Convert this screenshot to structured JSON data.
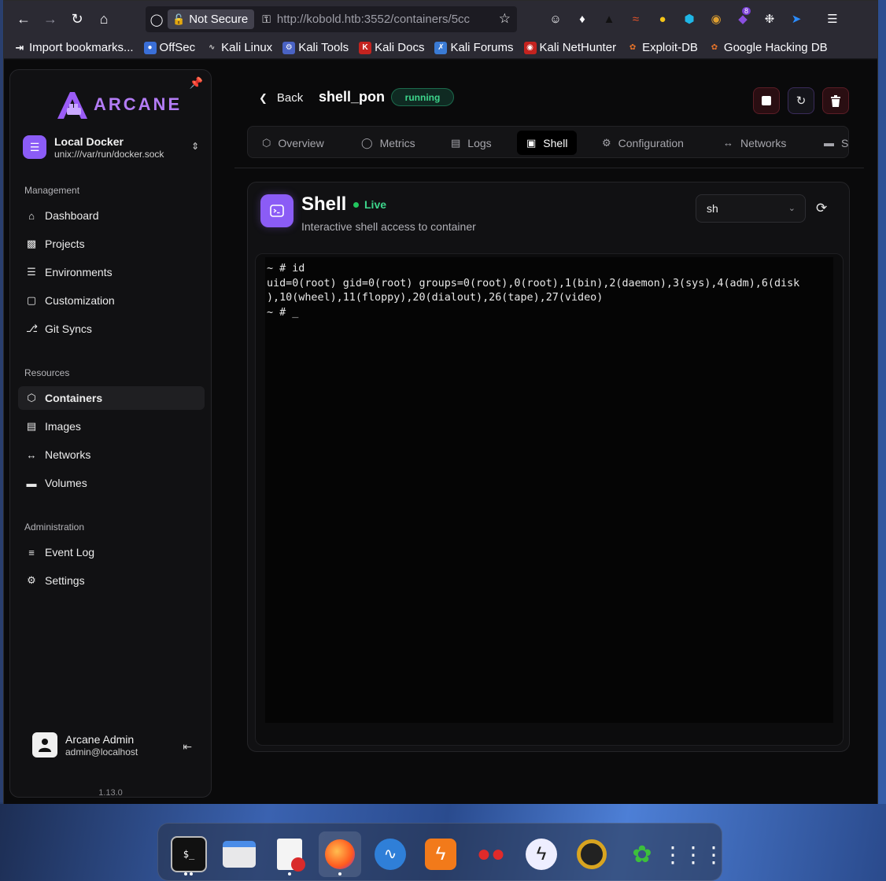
{
  "browser": {
    "security_label": "Not Secure",
    "url": "http://kobold.htb:3552/containers/5cc",
    "extension_badge": "8",
    "bookmarks": [
      {
        "label": "Import bookmarks...",
        "icon": "import-icon"
      },
      {
        "label": "OffSec",
        "icon": "offsec-icon"
      },
      {
        "label": "Kali Linux",
        "icon": "kali-icon"
      },
      {
        "label": "Kali Tools",
        "icon": "kali-tools-icon"
      },
      {
        "label": "Kali Docs",
        "icon": "kali-docs-icon"
      },
      {
        "label": "Kali Forums",
        "icon": "kali-forums-icon"
      },
      {
        "label": "Kali NetHunter",
        "icon": "nethunter-icon"
      },
      {
        "label": "Exploit-DB",
        "icon": "exploitdb-icon"
      },
      {
        "label": "Google Hacking DB",
        "icon": "ghdb-icon"
      }
    ]
  },
  "sidebar": {
    "brand": "ARCANE",
    "environment": {
      "name": "Local Docker",
      "socket": "unix:///var/run/docker.sock"
    },
    "sections": {
      "management": "Management",
      "resources": "Resources",
      "administration": "Administration"
    },
    "management_items": [
      "Dashboard",
      "Projects",
      "Environments",
      "Customization",
      "Git Syncs"
    ],
    "resource_items": [
      "Containers",
      "Images",
      "Networks",
      "Volumes"
    ],
    "admin_items": [
      "Event Log",
      "Settings"
    ],
    "active_item": "Containers",
    "user": {
      "name": "Arcane Admin",
      "email": "admin@localhost"
    },
    "version": "1.13.0"
  },
  "header": {
    "back_label": "Back",
    "container_name": "shell_pon",
    "status": "running"
  },
  "tabs": [
    "Overview",
    "Metrics",
    "Logs",
    "Shell",
    "Configuration",
    "Networks",
    "St"
  ],
  "active_tab": "Shell",
  "shell": {
    "title": "Shell",
    "live_label": "Live",
    "subtitle": "Interactive shell access to container",
    "shell_select": "sh",
    "terminal_lines": [
      "~ # id",
      "uid=0(root) gid=0(root) groups=0(root),0(root),1(bin),2(daemon),3(sys),4(adm),6(disk",
      "),10(wheel),11(floppy),20(dialout),26(tape),27(video)",
      "~ # _"
    ]
  },
  "colors": {
    "accent": "#8b5cf6",
    "brand": "#b37cf5",
    "status_green": "#3dd68c",
    "danger": "#5a1d26"
  }
}
